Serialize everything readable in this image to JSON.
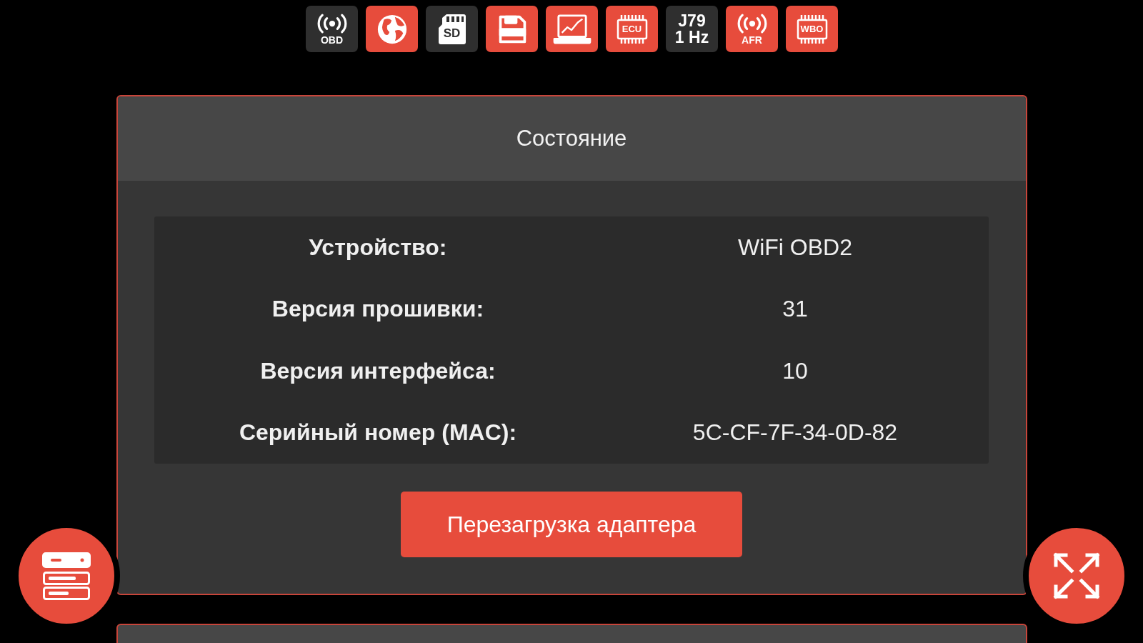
{
  "toolbar": [
    {
      "kind": "signal",
      "label": "OBD",
      "active": false
    },
    {
      "kind": "globe",
      "active": true
    },
    {
      "kind": "sd-card",
      "label": "SD",
      "active": false
    },
    {
      "kind": "floppy",
      "active": true
    },
    {
      "kind": "chart",
      "active": true
    },
    {
      "kind": "chip",
      "label": "ECU",
      "active": true
    },
    {
      "kind": "text",
      "lines": [
        "J79",
        "1 Hz"
      ],
      "active": false
    },
    {
      "kind": "signal",
      "label": "AFR",
      "active": true
    },
    {
      "kind": "chip",
      "label": "WBO",
      "active": true
    }
  ],
  "status_panel": {
    "title": "Состояние",
    "rows": [
      {
        "label": "Устройство:",
        "value": "WiFi OBD2"
      },
      {
        "label": "Версия прошивки:",
        "value": "31"
      },
      {
        "label": "Версия интерфейса:",
        "value": "10"
      },
      {
        "label": "Серийный номер (MAC):",
        "value": "5C-CF-7F-34-0D-82"
      }
    ],
    "restart_button": "Перезагрузка адаптера"
  },
  "floating_buttons": [
    {
      "kind": "server"
    },
    {
      "kind": "expand"
    }
  ]
}
